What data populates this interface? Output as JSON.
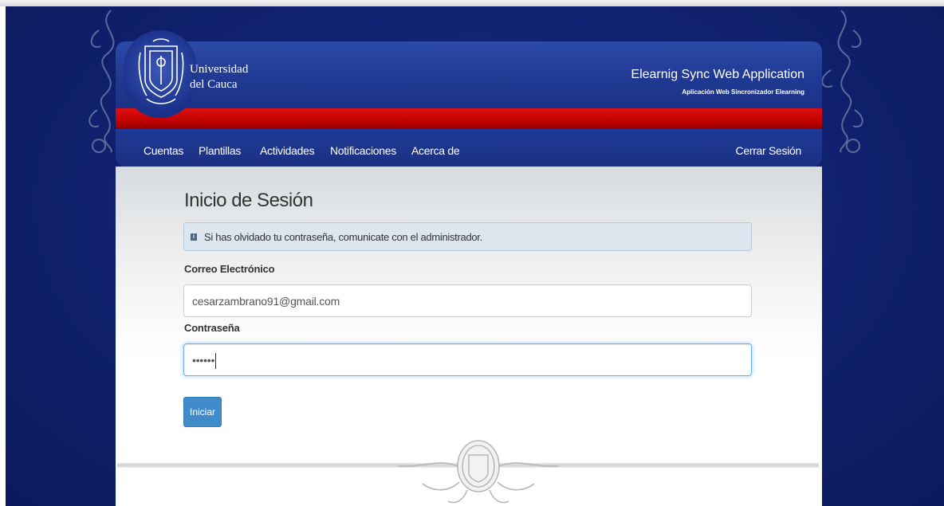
{
  "header": {
    "university_line1": "Universidad",
    "university_line2": "del Cauca",
    "app_title": "Elearnig Sync Web Application",
    "app_subtitle": "Aplicación Web Sincronizador Elearning",
    "logo_icon": "university-crest-icon"
  },
  "nav": {
    "items": [
      {
        "label": "Cuentas"
      },
      {
        "label": "Plantillas"
      },
      {
        "label": "Actividades"
      },
      {
        "label": "Notificaciones"
      },
      {
        "label": "Acerca de"
      }
    ],
    "logout": "Cerrar Sesión"
  },
  "main": {
    "title": "Inicio de Sesión",
    "alert": {
      "icon": "info-icon",
      "text": "Si has olvidado tu contraseña, comunicate con el administrador."
    },
    "email": {
      "label": "Correo Electrónico",
      "value": "cesarzambrano91@gmail.com"
    },
    "password": {
      "label": "Contraseña",
      "value": "••••••"
    },
    "submit_label": "Iniciar"
  },
  "colors": {
    "navy_background": "#112272",
    "header_blue": "#1f3891",
    "header_red": "#c00000",
    "button_primary": "#428bca"
  }
}
